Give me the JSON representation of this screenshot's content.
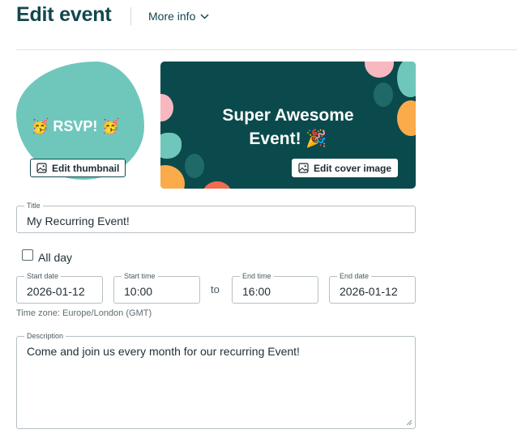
{
  "header": {
    "title": "Edit event",
    "more_info_label": "More info",
    "more_info_icon": "chevron-down-icon"
  },
  "thumbnail": {
    "text": "🥳 RSVP! 🥳",
    "edit_label": "Edit thumbnail",
    "edit_icon": "image-icon",
    "color": "#6fc7bc"
  },
  "cover": {
    "line1": "Super Awesome",
    "line2": "Event! 🎉",
    "edit_label": "Edit cover image",
    "edit_icon": "image-icon",
    "background": "#0b4a4c"
  },
  "form": {
    "title": {
      "label": "Title",
      "value": "My Recurring Event!"
    },
    "all_day": {
      "label": "All day",
      "checked": false
    },
    "start_date": {
      "label": "Start date",
      "value": "2026-01-12"
    },
    "start_time": {
      "label": "Start time",
      "value": "10:00"
    },
    "to_label": "to",
    "end_time": {
      "label": "End time",
      "value": "16:00"
    },
    "end_date": {
      "label": "End date",
      "value": "2026-01-12"
    },
    "timezone": "Time zone: Europe/London (GMT)",
    "description": {
      "label": "Description",
      "value": "Come and join us every month for our recurring Event!"
    }
  },
  "colors": {
    "brand": "#12474d",
    "teal_light": "#6fc7bc",
    "coral": "#f26c4f",
    "orange": "#fbab4a",
    "pink": "#f7b8c0"
  }
}
